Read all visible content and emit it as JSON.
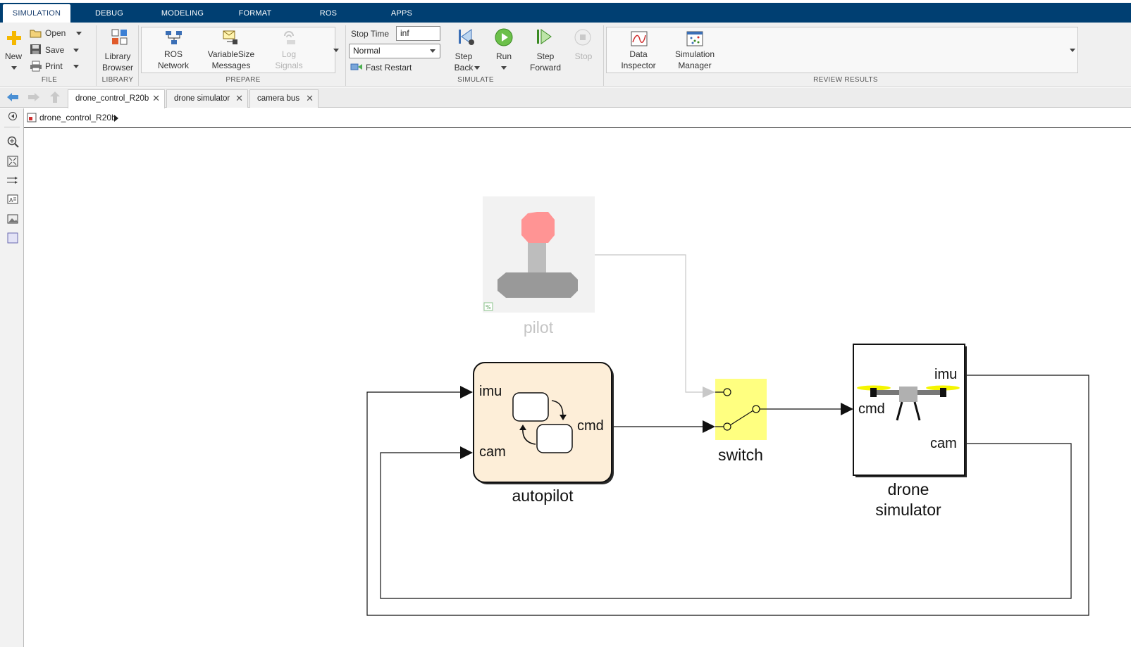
{
  "tabs": {
    "simulation": "SIMULATION",
    "debug": "DEBUG",
    "modeling": "MODELING",
    "format": "FORMAT",
    "ros": "ROS",
    "apps": "APPS"
  },
  "ribbon": {
    "file": {
      "new": "New",
      "open": "Open",
      "save": "Save",
      "print": "Print",
      "group": "FILE"
    },
    "library": {
      "browser_l1": "Library",
      "browser_l2": "Browser",
      "group": "LIBRARY"
    },
    "prepare": {
      "ros_l1": "ROS",
      "ros_l2": "Network",
      "varsize_l1": "VariableSize",
      "varsize_l2": "Messages",
      "log_l1": "Log",
      "log_l2": "Signals",
      "group": "PREPARE"
    },
    "simulate": {
      "stop_time_label": "Stop Time",
      "stop_time_value": "inf",
      "mode": "Normal",
      "fast_restart": "Fast Restart",
      "step_back_l1": "Step",
      "step_back_l2": "Back",
      "run": "Run",
      "step_fwd_l1": "Step",
      "step_fwd_l2": "Forward",
      "stop": "Stop",
      "group": "SIMULATE"
    },
    "review": {
      "data_l1": "Data",
      "data_l2": "Inspector",
      "sim_l1": "Simulation",
      "sim_l2": "Manager",
      "group": "REVIEW RESULTS"
    }
  },
  "doc_tabs": [
    "drone_control_R20b",
    "drone simulator",
    "camera bus"
  ],
  "breadcrumb": "drone_control_R20b",
  "diagram": {
    "pilot": "pilot",
    "autopilot": "autopilot",
    "autopilot_in1": "imu",
    "autopilot_in2": "cam",
    "autopilot_out": "cmd",
    "switch": "switch",
    "drone_l1": "drone",
    "drone_l2": "simulator",
    "drone_in": "cmd",
    "drone_out1": "imu",
    "drone_out2": "cam"
  },
  "colors": {
    "toolstrip": "#003f72",
    "switch_fill": "#ffff80",
    "chart_fill": "#fdeed8",
    "joystick_knob": "#ff9494"
  }
}
